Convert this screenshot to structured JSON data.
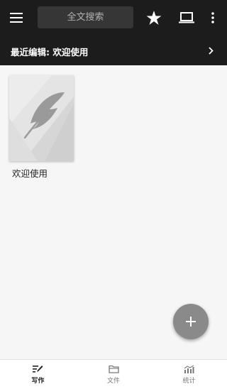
{
  "toolbar": {
    "search_placeholder": "全文搜索",
    "menu_icon": "hamburger-menu-icon",
    "star_icon": "star-icon",
    "laptop_icon": "laptop-icon",
    "more_icon": "more-vertical-icon"
  },
  "recent": {
    "label": "最近编辑: 欢迎使用",
    "chevron_icon": "chevron-right-icon"
  },
  "notes": [
    {
      "title": "欢迎使用",
      "thumbnail_icon": "feather-icon"
    }
  ],
  "fab": {
    "icon": "plus-icon"
  },
  "bottom_nav": {
    "items": [
      {
        "label": "写作",
        "icon": "write-icon",
        "active": true
      },
      {
        "label": "文件",
        "icon": "folder-icon",
        "active": false
      },
      {
        "label": "统计",
        "icon": "stats-icon",
        "active": false
      }
    ]
  },
  "colors": {
    "topbar": "#1c1c1c",
    "search_bg": "#363636",
    "content_bg": "#f6f6f6",
    "fab": "#8a8a8a"
  }
}
